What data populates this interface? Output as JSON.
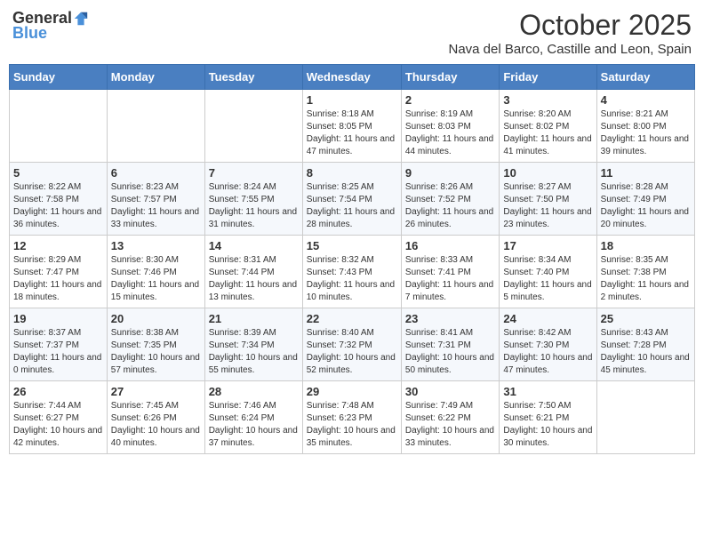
{
  "logo": {
    "general": "General",
    "blue": "Blue"
  },
  "header": {
    "month": "October 2025",
    "location": "Nava del Barco, Castille and Leon, Spain"
  },
  "weekdays": [
    "Sunday",
    "Monday",
    "Tuesday",
    "Wednesday",
    "Thursday",
    "Friday",
    "Saturday"
  ],
  "weeks": [
    [
      {
        "day": "",
        "info": ""
      },
      {
        "day": "",
        "info": ""
      },
      {
        "day": "",
        "info": ""
      },
      {
        "day": "1",
        "info": "Sunrise: 8:18 AM\nSunset: 8:05 PM\nDaylight: 11 hours and 47 minutes."
      },
      {
        "day": "2",
        "info": "Sunrise: 8:19 AM\nSunset: 8:03 PM\nDaylight: 11 hours and 44 minutes."
      },
      {
        "day": "3",
        "info": "Sunrise: 8:20 AM\nSunset: 8:02 PM\nDaylight: 11 hours and 41 minutes."
      },
      {
        "day": "4",
        "info": "Sunrise: 8:21 AM\nSunset: 8:00 PM\nDaylight: 11 hours and 39 minutes."
      }
    ],
    [
      {
        "day": "5",
        "info": "Sunrise: 8:22 AM\nSunset: 7:58 PM\nDaylight: 11 hours and 36 minutes."
      },
      {
        "day": "6",
        "info": "Sunrise: 8:23 AM\nSunset: 7:57 PM\nDaylight: 11 hours and 33 minutes."
      },
      {
        "day": "7",
        "info": "Sunrise: 8:24 AM\nSunset: 7:55 PM\nDaylight: 11 hours and 31 minutes."
      },
      {
        "day": "8",
        "info": "Sunrise: 8:25 AM\nSunset: 7:54 PM\nDaylight: 11 hours and 28 minutes."
      },
      {
        "day": "9",
        "info": "Sunrise: 8:26 AM\nSunset: 7:52 PM\nDaylight: 11 hours and 26 minutes."
      },
      {
        "day": "10",
        "info": "Sunrise: 8:27 AM\nSunset: 7:50 PM\nDaylight: 11 hours and 23 minutes."
      },
      {
        "day": "11",
        "info": "Sunrise: 8:28 AM\nSunset: 7:49 PM\nDaylight: 11 hours and 20 minutes."
      }
    ],
    [
      {
        "day": "12",
        "info": "Sunrise: 8:29 AM\nSunset: 7:47 PM\nDaylight: 11 hours and 18 minutes."
      },
      {
        "day": "13",
        "info": "Sunrise: 8:30 AM\nSunset: 7:46 PM\nDaylight: 11 hours and 15 minutes."
      },
      {
        "day": "14",
        "info": "Sunrise: 8:31 AM\nSunset: 7:44 PM\nDaylight: 11 hours and 13 minutes."
      },
      {
        "day": "15",
        "info": "Sunrise: 8:32 AM\nSunset: 7:43 PM\nDaylight: 11 hours and 10 minutes."
      },
      {
        "day": "16",
        "info": "Sunrise: 8:33 AM\nSunset: 7:41 PM\nDaylight: 11 hours and 7 minutes."
      },
      {
        "day": "17",
        "info": "Sunrise: 8:34 AM\nSunset: 7:40 PM\nDaylight: 11 hours and 5 minutes."
      },
      {
        "day": "18",
        "info": "Sunrise: 8:35 AM\nSunset: 7:38 PM\nDaylight: 11 hours and 2 minutes."
      }
    ],
    [
      {
        "day": "19",
        "info": "Sunrise: 8:37 AM\nSunset: 7:37 PM\nDaylight: 11 hours and 0 minutes."
      },
      {
        "day": "20",
        "info": "Sunrise: 8:38 AM\nSunset: 7:35 PM\nDaylight: 10 hours and 57 minutes."
      },
      {
        "day": "21",
        "info": "Sunrise: 8:39 AM\nSunset: 7:34 PM\nDaylight: 10 hours and 55 minutes."
      },
      {
        "day": "22",
        "info": "Sunrise: 8:40 AM\nSunset: 7:32 PM\nDaylight: 10 hours and 52 minutes."
      },
      {
        "day": "23",
        "info": "Sunrise: 8:41 AM\nSunset: 7:31 PM\nDaylight: 10 hours and 50 minutes."
      },
      {
        "day": "24",
        "info": "Sunrise: 8:42 AM\nSunset: 7:30 PM\nDaylight: 10 hours and 47 minutes."
      },
      {
        "day": "25",
        "info": "Sunrise: 8:43 AM\nSunset: 7:28 PM\nDaylight: 10 hours and 45 minutes."
      }
    ],
    [
      {
        "day": "26",
        "info": "Sunrise: 7:44 AM\nSunset: 6:27 PM\nDaylight: 10 hours and 42 minutes."
      },
      {
        "day": "27",
        "info": "Sunrise: 7:45 AM\nSunset: 6:26 PM\nDaylight: 10 hours and 40 minutes."
      },
      {
        "day": "28",
        "info": "Sunrise: 7:46 AM\nSunset: 6:24 PM\nDaylight: 10 hours and 37 minutes."
      },
      {
        "day": "29",
        "info": "Sunrise: 7:48 AM\nSunset: 6:23 PM\nDaylight: 10 hours and 35 minutes."
      },
      {
        "day": "30",
        "info": "Sunrise: 7:49 AM\nSunset: 6:22 PM\nDaylight: 10 hours and 33 minutes."
      },
      {
        "day": "31",
        "info": "Sunrise: 7:50 AM\nSunset: 6:21 PM\nDaylight: 10 hours and 30 minutes."
      },
      {
        "day": "",
        "info": ""
      }
    ]
  ]
}
